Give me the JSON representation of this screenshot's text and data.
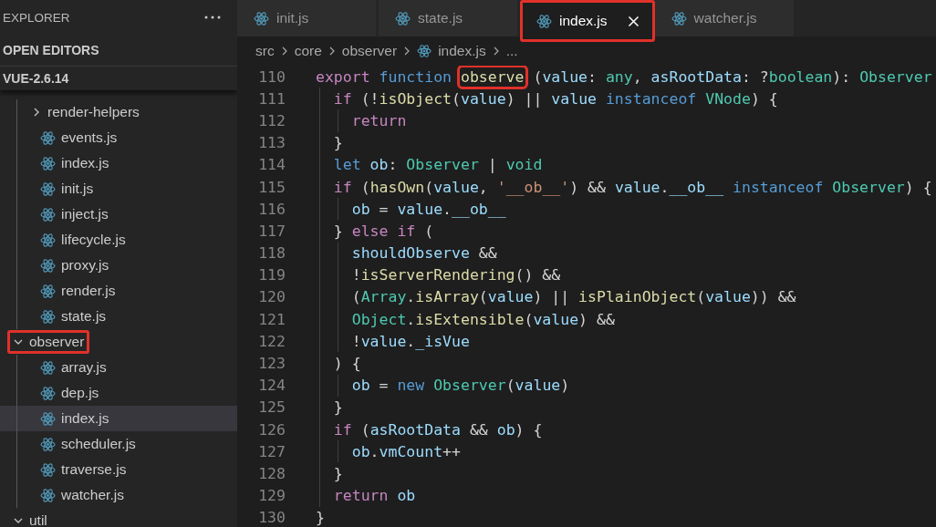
{
  "sidebar": {
    "title": "EXPLORER",
    "open_editors": "OPEN EDITORS",
    "project": "VUE-2.6.14",
    "tree": [
      {
        "kind": "folder",
        "children": [
          {
            "name": "render-helpers",
            "kind": "folder",
            "expanded": false,
            "selected": false,
            "marked": false
          },
          {
            "name": "events.js",
            "kind": "file",
            "selected": false,
            "marked": false
          },
          {
            "name": "index.js",
            "kind": "file",
            "selected": false,
            "marked": false
          },
          {
            "name": "init.js",
            "kind": "file",
            "selected": false,
            "marked": false
          },
          {
            "name": "inject.js",
            "kind": "file",
            "selected": false,
            "marked": false
          },
          {
            "name": "lifecycle.js",
            "kind": "file",
            "selected": false,
            "marked": false
          },
          {
            "name": "proxy.js",
            "kind": "file",
            "selected": false,
            "marked": false
          },
          {
            "name": "render.js",
            "kind": "file",
            "selected": false,
            "marked": false
          },
          {
            "name": "state.js",
            "kind": "file",
            "selected": false,
            "marked": false
          }
        ]
      },
      {
        "name": "observer",
        "kind": "folder",
        "expanded": true,
        "selected": false,
        "marked": true,
        "children": [
          {
            "name": "array.js",
            "kind": "file",
            "selected": false,
            "marked": false
          },
          {
            "name": "dep.js",
            "kind": "file",
            "selected": false,
            "marked": false
          },
          {
            "name": "index.js",
            "kind": "file",
            "selected": true,
            "marked": false
          },
          {
            "name": "scheduler.js",
            "kind": "file",
            "selected": false,
            "marked": false
          },
          {
            "name": "traverse.js",
            "kind": "file",
            "selected": false,
            "marked": false
          },
          {
            "name": "watcher.js",
            "kind": "file",
            "selected": false,
            "marked": false
          }
        ]
      },
      {
        "name": "util",
        "kind": "folder",
        "expanded": true,
        "selected": false,
        "marked": false
      }
    ]
  },
  "tabs": [
    {
      "label": "init.js",
      "selected": false,
      "marked": false
    },
    {
      "label": "state.js",
      "selected": false,
      "marked": false
    },
    {
      "label": "index.js",
      "selected": true,
      "marked": true
    },
    {
      "label": "watcher.js",
      "selected": false,
      "marked": false
    }
  ],
  "breadcrumbs": [
    {
      "label": "src",
      "kind": "folder"
    },
    {
      "label": "core",
      "kind": "folder"
    },
    {
      "label": "observer",
      "kind": "folder"
    },
    {
      "label": "index.js",
      "kind": "file"
    },
    {
      "label": "...",
      "kind": "more"
    }
  ],
  "code": [
    {
      "number": "110",
      "tokens": [
        {
          "text": "export ",
          "kind": "ctl"
        },
        {
          "text": "function ",
          "kind": "kw"
        },
        {
          "text": "observe",
          "kind": "fn",
          "marked": true
        },
        {
          "text": " (",
          "kind": "p"
        },
        {
          "text": "value",
          "kind": "var"
        },
        {
          "text": ": ",
          "kind": "p"
        },
        {
          "text": "any",
          "kind": "type"
        },
        {
          "text": ", ",
          "kind": "p"
        },
        {
          "text": "asRootData",
          "kind": "var"
        },
        {
          "text": ": ?",
          "kind": "p"
        },
        {
          "text": "boolean",
          "kind": "type"
        },
        {
          "text": "): ",
          "kind": "p"
        },
        {
          "text": "Observer",
          "kind": "type"
        }
      ]
    },
    {
      "number": "111",
      "tokens": [
        {
          "text": "  if",
          "kind": "ctl"
        },
        {
          "text": " (!",
          "kind": "p"
        },
        {
          "text": "isObject",
          "kind": "fn"
        },
        {
          "text": "(",
          "kind": "p"
        },
        {
          "text": "value",
          "kind": "var"
        },
        {
          "text": ") || ",
          "kind": "p"
        },
        {
          "text": "value ",
          "kind": "var"
        },
        {
          "text": "instanceof ",
          "kind": "kw"
        },
        {
          "text": "VNode",
          "kind": "type"
        },
        {
          "text": ") {",
          "kind": "p"
        }
      ]
    },
    {
      "number": "112",
      "tokens": [
        {
          "text": "    return",
          "kind": "ctl"
        }
      ]
    },
    {
      "number": "113",
      "tokens": [
        {
          "text": "  }",
          "kind": "p"
        }
      ]
    },
    {
      "number": "114",
      "tokens": [
        {
          "text": "  let ",
          "kind": "kw"
        },
        {
          "text": "ob",
          "kind": "var"
        },
        {
          "text": ": ",
          "kind": "p"
        },
        {
          "text": "Observer",
          "kind": "type"
        },
        {
          "text": " | ",
          "kind": "p"
        },
        {
          "text": "void",
          "kind": "type"
        }
      ]
    },
    {
      "number": "115",
      "tokens": [
        {
          "text": "  if",
          "kind": "ctl"
        },
        {
          "text": " (",
          "kind": "p"
        },
        {
          "text": "hasOwn",
          "kind": "fn"
        },
        {
          "text": "(",
          "kind": "p"
        },
        {
          "text": "value",
          "kind": "var"
        },
        {
          "text": ", ",
          "kind": "p"
        },
        {
          "text": "'__ob__'",
          "kind": "str"
        },
        {
          "text": ") && ",
          "kind": "p"
        },
        {
          "text": "value",
          "kind": "var"
        },
        {
          "text": ".",
          "kind": "p"
        },
        {
          "text": "__ob__ ",
          "kind": "var"
        },
        {
          "text": "instanceof ",
          "kind": "kw"
        },
        {
          "text": "Observer",
          "kind": "type"
        },
        {
          "text": ") {",
          "kind": "p"
        }
      ]
    },
    {
      "number": "116",
      "tokens": [
        {
          "text": "    ob",
          "kind": "var"
        },
        {
          "text": " = ",
          "kind": "p"
        },
        {
          "text": "value",
          "kind": "var"
        },
        {
          "text": ".",
          "kind": "p"
        },
        {
          "text": "__ob__",
          "kind": "var"
        }
      ]
    },
    {
      "number": "117",
      "tokens": [
        {
          "text": "  } ",
          "kind": "p"
        },
        {
          "text": "else if",
          "kind": "ctl"
        },
        {
          "text": " (",
          "kind": "p"
        }
      ]
    },
    {
      "number": "118",
      "tokens": [
        {
          "text": "    shouldObserve",
          "kind": "var"
        },
        {
          "text": " &&",
          "kind": "p"
        }
      ]
    },
    {
      "number": "119",
      "tokens": [
        {
          "text": "    !",
          "kind": "p"
        },
        {
          "text": "isServerRendering",
          "kind": "fn"
        },
        {
          "text": "() &&",
          "kind": "p"
        }
      ]
    },
    {
      "number": "120",
      "tokens": [
        {
          "text": "    (",
          "kind": "p"
        },
        {
          "text": "Array",
          "kind": "type"
        },
        {
          "text": ".",
          "kind": "p"
        },
        {
          "text": "isArray",
          "kind": "fn"
        },
        {
          "text": "(",
          "kind": "p"
        },
        {
          "text": "value",
          "kind": "var"
        },
        {
          "text": ") || ",
          "kind": "p"
        },
        {
          "text": "isPlainObject",
          "kind": "fn"
        },
        {
          "text": "(",
          "kind": "p"
        },
        {
          "text": "value",
          "kind": "var"
        },
        {
          "text": ")) &&",
          "kind": "p"
        }
      ]
    },
    {
      "number": "121",
      "tokens": [
        {
          "text": "    Object",
          "kind": "type"
        },
        {
          "text": ".",
          "kind": "p"
        },
        {
          "text": "isExtensible",
          "kind": "fn"
        },
        {
          "text": "(",
          "kind": "p"
        },
        {
          "text": "value",
          "kind": "var"
        },
        {
          "text": ") &&",
          "kind": "p"
        }
      ]
    },
    {
      "number": "122",
      "tokens": [
        {
          "text": "    !",
          "kind": "p"
        },
        {
          "text": "value",
          "kind": "var"
        },
        {
          "text": ".",
          "kind": "p"
        },
        {
          "text": "_isVue",
          "kind": "var"
        }
      ]
    },
    {
      "number": "123",
      "tokens": [
        {
          "text": "  ) {",
          "kind": "p"
        }
      ]
    },
    {
      "number": "124",
      "tokens": [
        {
          "text": "    ob",
          "kind": "var"
        },
        {
          "text": " = ",
          "kind": "p"
        },
        {
          "text": "new ",
          "kind": "kw"
        },
        {
          "text": "Observer",
          "kind": "type"
        },
        {
          "text": "(",
          "kind": "p"
        },
        {
          "text": "value",
          "kind": "var"
        },
        {
          "text": ")",
          "kind": "p"
        }
      ]
    },
    {
      "number": "125",
      "tokens": [
        {
          "text": "  }",
          "kind": "p"
        }
      ]
    },
    {
      "number": "126",
      "tokens": [
        {
          "text": "  if",
          "kind": "ctl"
        },
        {
          "text": " (",
          "kind": "p"
        },
        {
          "text": "asRootData",
          "kind": "var"
        },
        {
          "text": " && ",
          "kind": "p"
        },
        {
          "text": "ob",
          "kind": "var"
        },
        {
          "text": ") {",
          "kind": "p"
        }
      ]
    },
    {
      "number": "127",
      "tokens": [
        {
          "text": "    ob",
          "kind": "var"
        },
        {
          "text": ".",
          "kind": "p"
        },
        {
          "text": "vmCount",
          "kind": "var"
        },
        {
          "text": "++",
          "kind": "p"
        }
      ]
    },
    {
      "number": "128",
      "tokens": [
        {
          "text": "  }",
          "kind": "p"
        }
      ]
    },
    {
      "number": "129",
      "tokens": [
        {
          "text": "  return ",
          "kind": "ctl"
        },
        {
          "text": "ob",
          "kind": "var"
        }
      ]
    },
    {
      "number": "130",
      "tokens": [
        {
          "text": "}",
          "kind": "p"
        }
      ]
    }
  ]
}
